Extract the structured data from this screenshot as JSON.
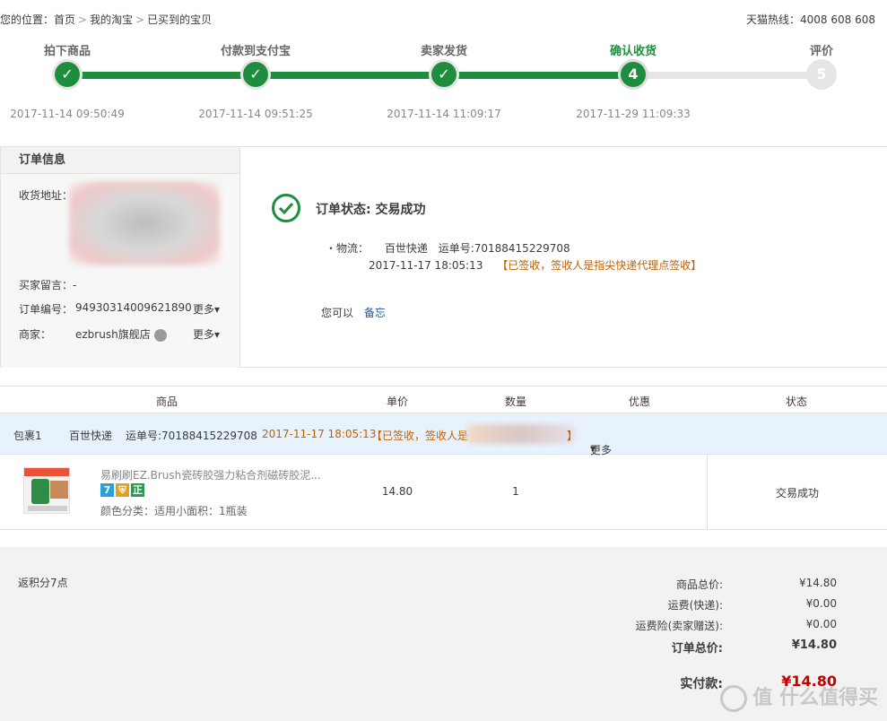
{
  "breadcrumb": {
    "prefix": "您的位置：",
    "home": "首页",
    "sep": ">",
    "my_taobao": "我的淘宝",
    "current": "已买到的宝贝"
  },
  "hotline": "天猫热线：4008 608 608",
  "progress": {
    "steps": [
      {
        "label": "拍下商品",
        "time": "2017-11-14 09:50:49",
        "state": "done",
        "mark": "✓"
      },
      {
        "label": "付款到支付宝",
        "time": "2017-11-14 09:51:25",
        "state": "done",
        "mark": "✓"
      },
      {
        "label": "卖家发货",
        "time": "2017-11-14 11:09:17",
        "state": "done",
        "mark": "✓"
      },
      {
        "label": "确认收货",
        "time": "2017-11-29 11:09:33",
        "state": "current",
        "mark": "4"
      },
      {
        "label": "评价",
        "time": "",
        "state": "todo",
        "mark": "5"
      }
    ],
    "done_color": "#1e8e3e",
    "todo_color": "#e6e6e6"
  },
  "order_info": {
    "title": "订单信息",
    "address_label": "收货地址：",
    "buyer_msg_label": "买家留言：",
    "buyer_msg_value": "-",
    "order_no_label": "订单编号：",
    "order_no_value": "94930314009621890",
    "more_label": "更多",
    "seller_label": "商家：",
    "seller_value": "ezbrush旗舰店",
    "seller_more_label": "更多"
  },
  "status": {
    "title": "订单状态: 交易成功",
    "logistics_label": "・物流：",
    "courier": "百世快递",
    "tracking_label": "运单号:",
    "tracking_no": "70188415229708",
    "logi_time": "2017-11-17 18:05:13",
    "logi_desc": "【已签收，签收人是指尖快递代理点签收】",
    "you_can": "您可以",
    "memo_link": "备忘"
  },
  "goods_table": {
    "headers": [
      "商品",
      "单价",
      "数量",
      "优惠",
      "状态"
    ],
    "package": {
      "name": "包裹1",
      "courier": "百世快递",
      "tracking": "运单号:70188415229708",
      "time": "2017-11-17 18:05:13",
      "desc_prefix": "【已签收，签收人是",
      "desc_suffix": "】",
      "more": "更多"
    },
    "item": {
      "title": "易刷刷EZ.Brush瓷砖胶强力粘合剂磁砖胶泥...",
      "badges": [
        "7",
        "⛨",
        "正"
      ],
      "sku": "颜色分类：适用小面积：1瓶装",
      "price": "14.80",
      "qty": "1",
      "discount": "",
      "status": "交易成功"
    }
  },
  "summary": {
    "points": "返积分7点",
    "rows": [
      {
        "label": "商品总价:",
        "value": "¥14.80"
      },
      {
        "label": "运费(快递):",
        "value": "¥0.00"
      },
      {
        "label": "运费险(卖家赠送):",
        "value": "¥0.00"
      },
      {
        "label": "订单总价:",
        "value": "¥14.80"
      }
    ],
    "paid_label": "实付款:",
    "paid_value": "¥14.80",
    "paid_color": "#c40000"
  },
  "watermark": "值 什么值得买"
}
